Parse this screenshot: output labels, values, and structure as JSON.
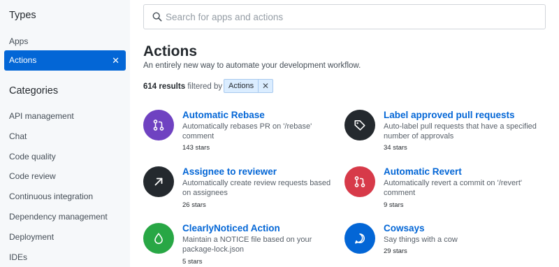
{
  "sidebar": {
    "types_heading": "Types",
    "apps_label": "Apps",
    "selected_label": "Actions",
    "selected_clear": "✕",
    "categories_heading": "Categories",
    "categories": [
      "API management",
      "Chat",
      "Code quality",
      "Code review",
      "Continuous integration",
      "Dependency management",
      "Deployment",
      "IDEs"
    ]
  },
  "search": {
    "placeholder": "Search for apps and actions",
    "value": ""
  },
  "main": {
    "title": "Actions",
    "subtitle": "An entirely new way to automate your development workflow.",
    "results_count": "614 results",
    "results_filtered_by": "filtered by",
    "filter_chip_label": "Actions",
    "filter_chip_remove": "✕"
  },
  "cards": [
    {
      "title": "Automatic Rebase",
      "description": "Automatically rebases PR on '/rebase' comment",
      "stars": "143 stars",
      "icon": "git-pull-request-icon",
      "color": "#6f42c1"
    },
    {
      "title": "Label approved pull requests",
      "description": "Auto-label pull requests that have a specified number of approvals",
      "stars": "34 stars",
      "icon": "tag-icon",
      "color": "#24292e"
    },
    {
      "title": "Assignee to reviewer",
      "description": "Automatically create review requests based on assignees",
      "stars": "26 stars",
      "icon": "arrow-up-right-icon",
      "color": "#24292e"
    },
    {
      "title": "Automatic Revert",
      "description": "Automatically revert a commit on '/revert' comment",
      "stars": "9 stars",
      "icon": "git-pull-request-icon",
      "color": "#d73a49"
    },
    {
      "title": "ClearlyNoticed Action",
      "description": "Maintain a NOTICE file based on your package-lock.json",
      "stars": "5 stars",
      "icon": "droplet-icon",
      "color": "#28a745"
    },
    {
      "title": "Cowsays",
      "description": "Say things with a cow",
      "stars": "29 stars",
      "icon": "comment-icon",
      "color": "#0366d6"
    }
  ]
}
